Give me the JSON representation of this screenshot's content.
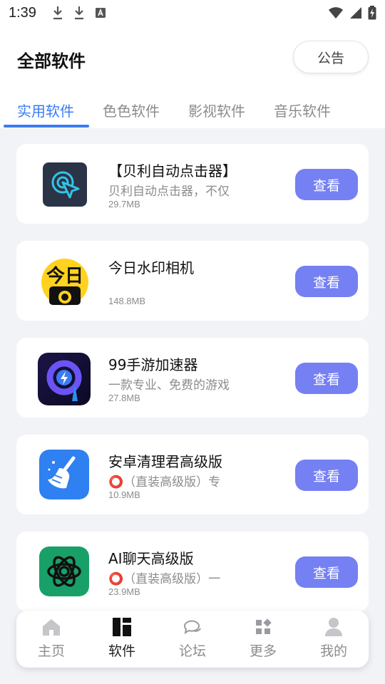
{
  "status_bar": {
    "time": "1:39",
    "left_icons": [
      "download-icon",
      "download-icon",
      "text-notification-icon"
    ],
    "right_icons": [
      "wifi-icon",
      "cell-signal-icon",
      "battery-charging-icon"
    ]
  },
  "header": {
    "title": "全部软件",
    "notice_label": "公告"
  },
  "tabs": [
    {
      "label": "实用软件",
      "active": true
    },
    {
      "label": "色色软件",
      "active": false
    },
    {
      "label": "影视软件",
      "active": false
    },
    {
      "label": "音乐软件",
      "active": false
    }
  ],
  "apps": [
    {
      "name": "【贝利自动点击器】",
      "description": "贝利自动点击器，不仅",
      "size": "29.7MB",
      "button": "查看",
      "icon": "auto-clicker-icon"
    },
    {
      "name": "今日水印相机",
      "description": "",
      "size": "148.8MB",
      "button": "查看",
      "icon": "watermark-camera-icon"
    },
    {
      "name": "99手游加速器",
      "description": "一款专业、免费的游戏",
      "size": "27.8MB",
      "button": "查看",
      "icon": "game-accelerator-icon"
    },
    {
      "name": "安卓清理君高级版",
      "description": "⭕（直装高级版）专",
      "size": "10.9MB",
      "button": "查看",
      "icon": "cleaner-broom-icon"
    },
    {
      "name": "AI聊天高级版",
      "description": "⭕（直装高级版）一",
      "size": "23.9MB",
      "button": "查看",
      "icon": "ai-chat-icon"
    }
  ],
  "bottom_nav": [
    {
      "label": "主页",
      "icon": "home-icon",
      "active": false
    },
    {
      "label": "软件",
      "icon": "apps-grid-icon",
      "active": true
    },
    {
      "label": "论坛",
      "icon": "chat-bubbles-icon",
      "active": false
    },
    {
      "label": "更多",
      "icon": "more-grid-icon",
      "active": false
    },
    {
      "label": "我的",
      "icon": "profile-icon",
      "active": false
    }
  ],
  "colors": {
    "accent": "#3b7cf5",
    "button": "#7580f3",
    "background": "#f2f3f7"
  }
}
